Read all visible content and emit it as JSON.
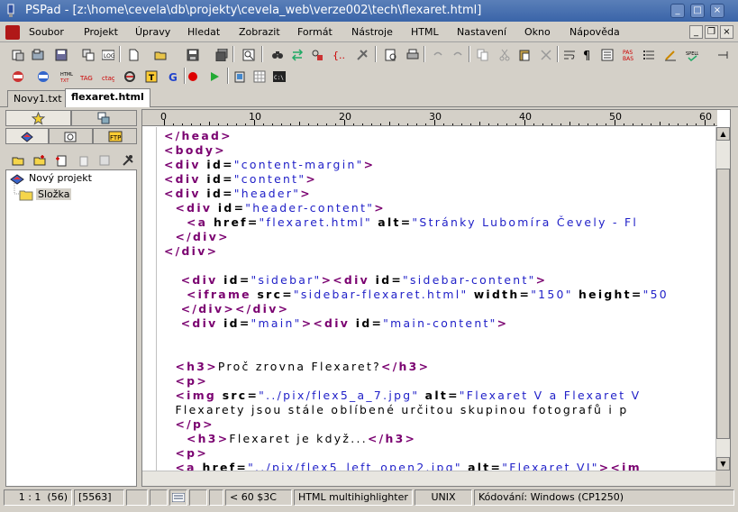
{
  "window": {
    "title": "PSPad - [z:\\home\\cevela\\db\\projekty\\cevela_web\\verze002\\tech\\flexaret.html]"
  },
  "titlebar_buttons": {
    "minimize": "_",
    "maximize": "□",
    "close": "×"
  },
  "menu": [
    {
      "label": "Soubor",
      "key": "S"
    },
    {
      "label": "Projekt",
      "key": "P"
    },
    {
      "label": "Úpravy",
      "key": "Ú"
    },
    {
      "label": "Hledat",
      "key": "H"
    },
    {
      "label": "Zobrazit",
      "key": "Z"
    },
    {
      "label": "Formát",
      "key": "F"
    },
    {
      "label": "Nástroje",
      "key": "N"
    },
    {
      "label": "HTML",
      "key": "H"
    },
    {
      "label": "Nastavení",
      "key": "N"
    },
    {
      "label": "Okno",
      "key": "O"
    },
    {
      "label": "Nápověda",
      "key": "N"
    }
  ],
  "file_tabs": [
    {
      "label": "Novy1.txt",
      "active": false
    },
    {
      "label": "flexaret.html",
      "active": true
    }
  ],
  "project_tree": {
    "root": "Nový projekt",
    "child": "Složka"
  },
  "ruler": [
    "0",
    "10",
    "20",
    "30",
    "40",
    "50",
    "60"
  ],
  "code_lines": [
    [
      {
        "c": "k",
        "t": "</head>"
      }
    ],
    [
      {
        "c": "k",
        "t": "<body>"
      }
    ],
    [
      {
        "c": "k",
        "t": "<div "
      },
      {
        "c": "a",
        "t": "id="
      },
      {
        "c": "v",
        "t": "\"content-margin\""
      },
      {
        "c": "k",
        "t": ">"
      }
    ],
    [
      {
        "c": "k",
        "t": "<div "
      },
      {
        "c": "a",
        "t": "id="
      },
      {
        "c": "v",
        "t": "\"content\""
      },
      {
        "c": "k",
        "t": ">"
      }
    ],
    [
      {
        "c": "k",
        "t": "<div "
      },
      {
        "c": "a",
        "t": "id="
      },
      {
        "c": "v",
        "t": "\"header\""
      },
      {
        "c": "k",
        "t": ">"
      }
    ],
    [
      {
        "c": "t",
        "t": "  "
      },
      {
        "c": "k",
        "t": "<div "
      },
      {
        "c": "a",
        "t": "id="
      },
      {
        "c": "v",
        "t": "\"header-content\""
      },
      {
        "c": "k",
        "t": ">"
      }
    ],
    [
      {
        "c": "t",
        "t": "    "
      },
      {
        "c": "k",
        "t": "<a "
      },
      {
        "c": "a",
        "t": "href="
      },
      {
        "c": "v",
        "t": "\"flexaret.html\""
      },
      {
        "c": "t",
        "t": " "
      },
      {
        "c": "a",
        "t": "alt="
      },
      {
        "c": "v",
        "t": "\"Stránky Lubomíra Čevely - Fl"
      }
    ],
    [
      {
        "c": "t",
        "t": "  "
      },
      {
        "c": "k",
        "t": "</div>"
      }
    ],
    [
      {
        "c": "k",
        "t": "</div>"
      }
    ],
    [],
    [
      {
        "c": "t",
        "t": "   "
      },
      {
        "c": "k",
        "t": "<div "
      },
      {
        "c": "a",
        "t": "id="
      },
      {
        "c": "v",
        "t": "\"sidebar\""
      },
      {
        "c": "k",
        "t": "><div "
      },
      {
        "c": "a",
        "t": "id="
      },
      {
        "c": "v",
        "t": "\"sidebar-content\""
      },
      {
        "c": "k",
        "t": ">"
      }
    ],
    [
      {
        "c": "t",
        "t": "    "
      },
      {
        "c": "k",
        "t": "<iframe "
      },
      {
        "c": "a",
        "t": "src="
      },
      {
        "c": "v",
        "t": "\"sidebar-flexaret.html\""
      },
      {
        "c": "t",
        "t": " "
      },
      {
        "c": "a",
        "t": "width="
      },
      {
        "c": "v",
        "t": "\"150\""
      },
      {
        "c": "t",
        "t": " "
      },
      {
        "c": "a",
        "t": "height="
      },
      {
        "c": "v",
        "t": "\"50"
      }
    ],
    [
      {
        "c": "t",
        "t": "   "
      },
      {
        "c": "k",
        "t": "</div></div>"
      }
    ],
    [
      {
        "c": "t",
        "t": "   "
      },
      {
        "c": "k",
        "t": "<div "
      },
      {
        "c": "a",
        "t": "id="
      },
      {
        "c": "v",
        "t": "\"main\""
      },
      {
        "c": "k",
        "t": "><div "
      },
      {
        "c": "a",
        "t": "id="
      },
      {
        "c": "v",
        "t": "\"main-content\""
      },
      {
        "c": "k",
        "t": ">"
      }
    ],
    [],
    [],
    [
      {
        "c": "t",
        "t": "  "
      },
      {
        "c": "k",
        "t": "<h3>"
      },
      {
        "c": "t",
        "t": "Proč zrovna Flexaret?"
      },
      {
        "c": "k",
        "t": "</h3>"
      }
    ],
    [
      {
        "c": "t",
        "t": "  "
      },
      {
        "c": "k",
        "t": "<p>"
      }
    ],
    [
      {
        "c": "t",
        "t": "  "
      },
      {
        "c": "k",
        "t": "<img "
      },
      {
        "c": "a",
        "t": "src="
      },
      {
        "c": "v",
        "t": "\"../pix/flex5_a_7.jpg\""
      },
      {
        "c": "t",
        "t": " "
      },
      {
        "c": "a",
        "t": "alt="
      },
      {
        "c": "v",
        "t": "\"Flexaret V a Flexaret V"
      }
    ],
    [
      {
        "c": "t",
        "t": "  Flexarety jsou stále oblíbené určitou skupinou fotografů i p"
      }
    ],
    [
      {
        "c": "t",
        "t": "  "
      },
      {
        "c": "k",
        "t": "</p>"
      }
    ],
    [
      {
        "c": "t",
        "t": "    "
      },
      {
        "c": "k",
        "t": "<h3>"
      },
      {
        "c": "t",
        "t": "Flexaret je když..."
      },
      {
        "c": "k",
        "t": "</h3>"
      }
    ],
    [
      {
        "c": "t",
        "t": "  "
      },
      {
        "c": "k",
        "t": "<p>"
      }
    ],
    [
      {
        "c": "t",
        "t": "  "
      },
      {
        "c": "k",
        "t": "<a "
      },
      {
        "c": "a",
        "t": "href="
      },
      {
        "c": "v",
        "t": "\"../pix/flex5_left_open2.jpg\""
      },
      {
        "c": "t",
        "t": " "
      },
      {
        "c": "a",
        "t": "alt="
      },
      {
        "c": "v",
        "t": "\"Flexaret VI\""
      },
      {
        "c": "k",
        "t": "><im"
      }
    ]
  ],
  "status": {
    "position": "1 : 1",
    "selection": "(56)",
    "size": "[5563]",
    "char_info": "<  60  $3C",
    "highlighter": "HTML multihighlighter",
    "line_end": "UNIX",
    "encoding": "Kódování: Windows (CP1250)"
  },
  "colors": {
    "tag": "#7a0070",
    "value": "#2020c8",
    "titlebar": "#4a72b0"
  }
}
